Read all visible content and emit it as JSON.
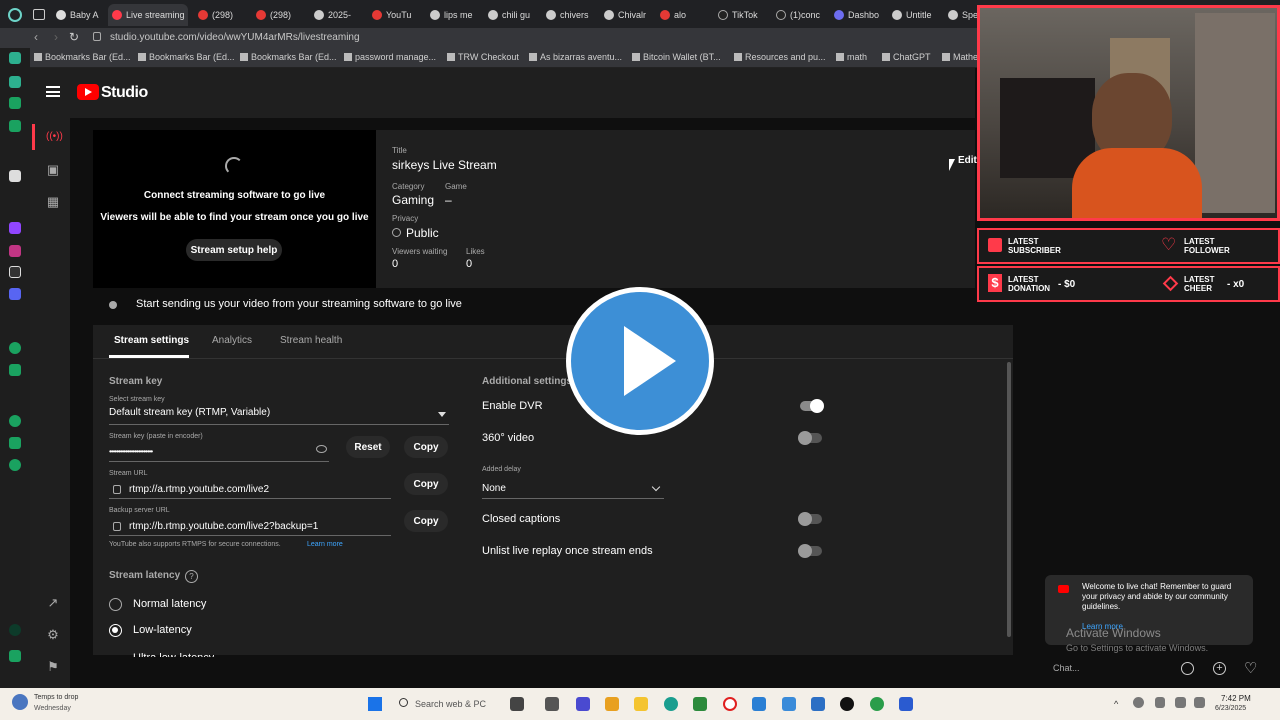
{
  "browser": {
    "tabs": [
      "Baby A",
      "Live streaming",
      "(298)",
      "(298)",
      "2025-",
      "YouTu",
      "lips me",
      "chili gu",
      "chivers",
      "Chivalr",
      "alo",
      "TikTok",
      "(1)conc",
      "Dashbo",
      "Untitle",
      "Spec"
    ],
    "url": "studio.youtube.com/video/wwYUM4arMRs/livestreaming",
    "bookmarks": [
      "Bookmarks Bar (Ed...",
      "Bookmarks Bar (Ed...",
      "Bookmarks Bar (Ed...",
      "password manage...",
      "TRW Checkout",
      "As bizarras aventu...",
      "Bitcoin Wallet (BT...",
      "Resources and pu...",
      "math",
      "ChatGPT",
      "Mathe"
    ]
  },
  "studio": {
    "logo": "Studio",
    "preview": {
      "line1": "Connect streaming software to go live",
      "line2": "Viewers will be able to find your stream once you go live",
      "help_button": "Stream setup help"
    },
    "details": {
      "title_label": "Title",
      "title": "sirkeys Live Stream",
      "category_label": "Category",
      "category": "Gaming",
      "game_label": "Game",
      "game": "–",
      "privacy_label": "Privacy",
      "privacy": "Public",
      "viewers_label": "Viewers waiting",
      "viewers": "0",
      "likes_label": "Likes",
      "likes": "0",
      "edit": "Edit"
    },
    "status": "Start sending us your video from your streaming software to go live",
    "tabs": [
      "Stream settings",
      "Analytics",
      "Stream health"
    ],
    "stream_key": {
      "heading": "Stream key",
      "select_label": "Select stream key",
      "select_value": "Default stream key (RTMP, Variable)",
      "key_label": "Stream key (paste in encoder)",
      "key_value": "••••••••••••••••••••••••",
      "reset": "Reset",
      "copy": "Copy",
      "url_label": "Stream URL",
      "url_value": "rtmp://a.rtmp.youtube.com/live2",
      "backup_label": "Backup server URL",
      "backup_value": "rtmp://b.rtmp.youtube.com/live2?backup=1",
      "note": "YouTube also supports RTMPS for secure connections.",
      "learn_more": "Learn more"
    },
    "latency": {
      "heading": "Stream latency",
      "options": [
        "Normal latency",
        "Low-latency",
        "Ultra low-latency"
      ],
      "selected": "Low-latency"
    },
    "additional": {
      "heading": "Additional settings",
      "dvr": "Enable DVR",
      "dvr_on": true,
      "video360": "360° video",
      "delay_label": "Added delay",
      "delay_value": "None",
      "captions": "Closed captions",
      "unlist": "Unlist live replay once stream ends"
    }
  },
  "overlay": {
    "latest_subscriber": "LATEST SUBSCRIBER",
    "latest_follower": "LATEST FOLLOWER",
    "latest_donation": "LATEST DONATION",
    "donation_value": "- $0",
    "latest_cheer": "LATEST CHEER",
    "cheer_value": "- x0"
  },
  "chat": {
    "welcome": "Welcome to live chat! Remember to guard your privacy and abide by our community guidelines.",
    "learn_more": "Learn more",
    "placeholder": "Chat...",
    "activate_title": "Activate Windows",
    "activate_sub": "Go to Settings to activate Windows."
  },
  "taskbar": {
    "weather_line1": "Temps to drop",
    "weather_line2": "Wednesday",
    "search": "Search web & PC",
    "time": "7:42 PM",
    "date": "6/23/2025"
  },
  "colors": {
    "accent_red": "#ff3a4a",
    "play_blue": "#3d8fd6",
    "link_blue": "#3ea6ff"
  }
}
